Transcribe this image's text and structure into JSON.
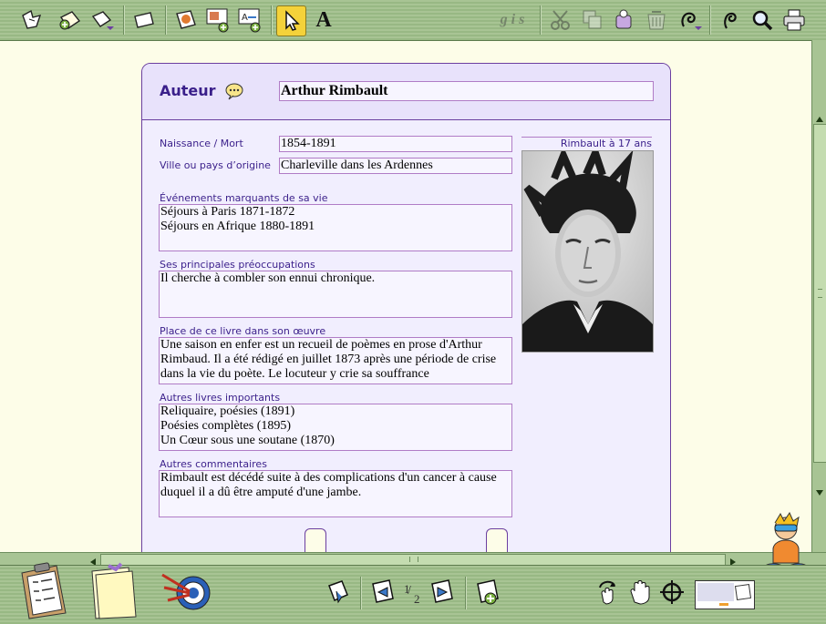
{
  "toolbar_top": {
    "format_hint": "g i s",
    "text_tool_label": "A"
  },
  "card": {
    "header": {
      "label": "Auteur",
      "name": "Arthur Rimbault"
    },
    "fields": {
      "birth_death": {
        "label": "Naissance / Mort",
        "value": "1854-1891"
      },
      "origin": {
        "label": "Ville ou pays d’origine",
        "value": "Charleville dans les Ardennes"
      },
      "events": {
        "label": "Événements marquants de sa vie",
        "value": "Séjours à Paris 1871-1872\nSéjours en Afrique 1880-1891"
      },
      "concerns": {
        "label": "Ses principales préoccupations",
        "value": "Il cherche à combler son ennui chronique."
      },
      "place": {
        "label": "Place de ce livre dans son œuvre",
        "value": "Une saison en enfer est un recueil de poèmes en prose d'Arthur Rimbaud. Il a été rédigé en juillet 1873 après une période de crise dans la vie du poète. Le locuteur y crie sa souffrance"
      },
      "other_books": {
        "label": "Autres livres importants",
        "value": "Reliquaire, poésies (1891)\nPoésies complètes (1895)\nUn Cœur sous une soutane (1870)"
      },
      "comments": {
        "label": "Autres commentaires",
        "value": "Rimbault est décédé suite à des complications d'un cancer à cause duquel il a dû être amputé d'une jambe."
      }
    },
    "photo_caption": "Rimbault à 17 ans"
  },
  "bottom_bar": {
    "page_num": "1",
    "page_den": "2"
  }
}
